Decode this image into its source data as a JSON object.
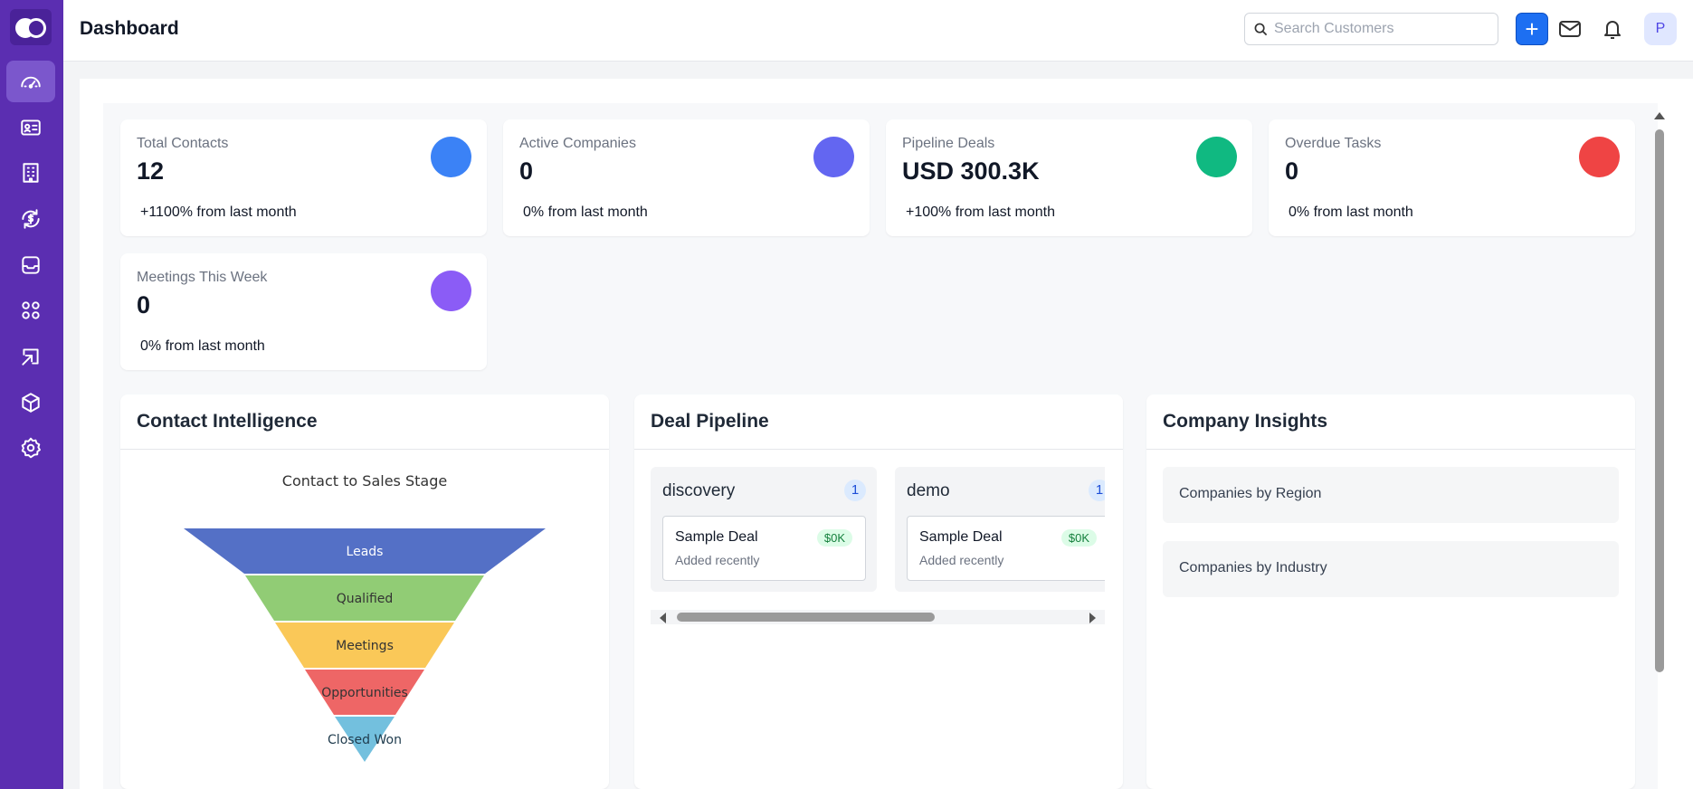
{
  "header": {
    "title": "Dashboard",
    "search_placeholder": "Search Customers",
    "add_label": "+",
    "avatar_initial": "P"
  },
  "sidebar": {
    "items": [
      {
        "name": "dashboard",
        "icon": "gauge-icon",
        "active": true
      },
      {
        "name": "contacts",
        "icon": "id-card-icon"
      },
      {
        "name": "companies",
        "icon": "building-icon"
      },
      {
        "name": "deals",
        "icon": "dollar-cycle-icon"
      },
      {
        "name": "inbox",
        "icon": "inbox-icon"
      },
      {
        "name": "apps",
        "icon": "command-icon"
      },
      {
        "name": "import",
        "icon": "import-icon"
      },
      {
        "name": "products",
        "icon": "box-icon"
      },
      {
        "name": "settings",
        "icon": "gear-icon"
      }
    ]
  },
  "stats": [
    {
      "label": "Total Contacts",
      "value": "12",
      "change": "+1100% from last month",
      "color": "#3b82f6"
    },
    {
      "label": "Active Companies",
      "value": "0",
      "change": "0% from last month",
      "color": "#6366f1"
    },
    {
      "label": "Pipeline Deals",
      "value": "USD 300.3K",
      "change": "+100% from last month",
      "color": "#10b981"
    },
    {
      "label": "Overdue Tasks",
      "value": "0",
      "change": "0% from last month",
      "color": "#ef4444"
    },
    {
      "label": "Meetings This Week",
      "value": "0",
      "change": "0% from last month",
      "color": "#8b5cf6"
    }
  ],
  "contact_intelligence": {
    "title": "Contact Intelligence",
    "chart_title": "Contact to Sales Stage",
    "stages": [
      {
        "label": "Leads",
        "color": "#5470c6"
      },
      {
        "label": "Qualified",
        "color": "#91cc75"
      },
      {
        "label": "Meetings",
        "color": "#fac858"
      },
      {
        "label": "Opportunities",
        "color": "#ee6666"
      },
      {
        "label": "Closed Won",
        "color": "#73c0de"
      }
    ]
  },
  "deal_pipeline": {
    "title": "Deal Pipeline",
    "columns": [
      {
        "name": "discovery",
        "count": "1",
        "deal": {
          "name": "Sample Deal",
          "value": "$0K",
          "sub": "Added recently"
        }
      },
      {
        "name": "demo",
        "count": "1",
        "deal": {
          "name": "Sample Deal",
          "value": "$0K",
          "sub": "Added recently"
        }
      }
    ]
  },
  "company_insights": {
    "title": "Company Insights",
    "items": [
      "Companies by Region",
      "Companies by Industry"
    ]
  }
}
